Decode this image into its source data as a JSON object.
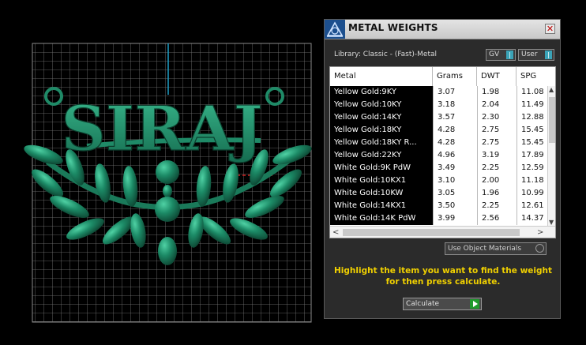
{
  "viewport": {
    "model_text": "SIRAJ",
    "model_color": "#1f8a67"
  },
  "panel": {
    "title": "METAL WEIGHTS",
    "close_glyph": "✕",
    "library": "Library: Classic - (Fast)-Metal",
    "toggle_gv": "GV",
    "toggle_user": "User",
    "table": {
      "headers": [
        "Metal",
        "Grams",
        "DWT",
        "SPG"
      ],
      "rows": [
        {
          "metal": "Yellow Gold:9KY",
          "grams": "3.07",
          "dwt": "1.98",
          "spg": "11.08"
        },
        {
          "metal": "Yellow Gold:10KY",
          "grams": "3.18",
          "dwt": "2.04",
          "spg": "11.49"
        },
        {
          "metal": "Yellow Gold:14KY",
          "grams": "3.57",
          "dwt": "2.30",
          "spg": "12.88"
        },
        {
          "metal": "Yellow Gold:18KY",
          "grams": "4.28",
          "dwt": "2.75",
          "spg": "15.45"
        },
        {
          "metal": "Yellow Gold:18KY R...",
          "grams": "4.28",
          "dwt": "2.75",
          "spg": "15.45"
        },
        {
          "metal": "Yellow Gold:22KY",
          "grams": "4.96",
          "dwt": "3.19",
          "spg": "17.89"
        },
        {
          "metal": "White Gold:9K PdW",
          "grams": "3.49",
          "dwt": "2.25",
          "spg": "12.59"
        },
        {
          "metal": "White Gold:10KX1",
          "grams": "3.10",
          "dwt": "2.00",
          "spg": "11.18"
        },
        {
          "metal": "White Gold:10KW",
          "grams": "3.05",
          "dwt": "1.96",
          "spg": "10.99"
        },
        {
          "metal": "White Gold:14KX1",
          "grams": "3.50",
          "dwt": "2.25",
          "spg": "12.61"
        },
        {
          "metal": "White Gold:14K PdW",
          "grams": "3.99",
          "dwt": "2.56",
          "spg": "14.37"
        }
      ]
    },
    "use_object_materials": "Use Object Materials",
    "hint": "Highlight the item you want to find the weight for then press calculate.",
    "calculate": "Calculate",
    "colors": {
      "hint_text": "#f0d000",
      "accent_blue": "#1c4f8e",
      "toggle_tick": "#3aa3b7",
      "calculate_play": "#1f9a2c"
    }
  }
}
